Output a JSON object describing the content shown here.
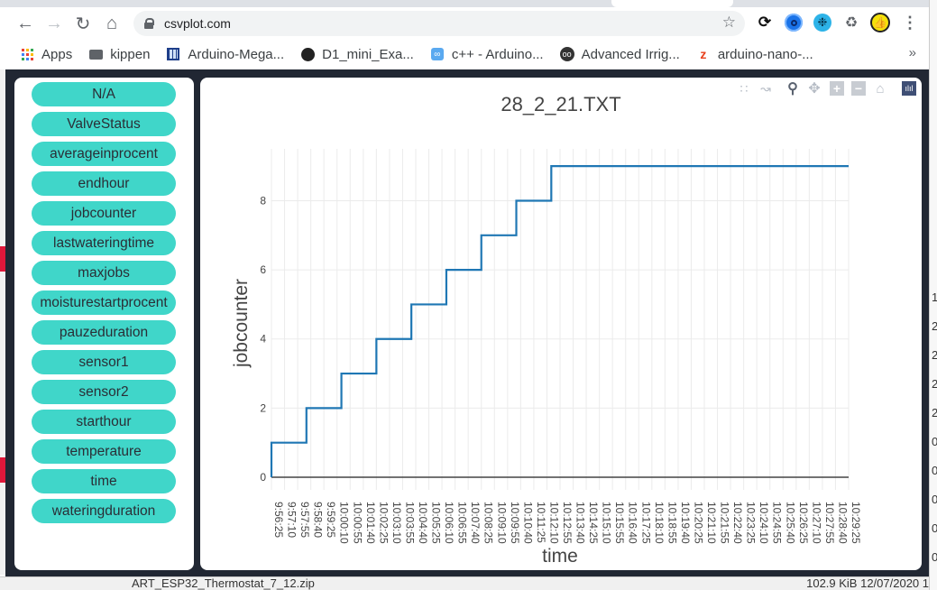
{
  "browser": {
    "url": "csvplot.com",
    "bookmarks": [
      {
        "label": "Apps",
        "icon": "apps-grid-icon"
      },
      {
        "label": "kippen",
        "icon": "folder-icon"
      },
      {
        "label": "Arduino-Mega...",
        "icon": "grid-site-icon"
      },
      {
        "label": "D1_mini_Exa...",
        "icon": "github-icon"
      },
      {
        "label": "c++ - Arduino...",
        "icon": "infinity-site-icon"
      },
      {
        "label": "Advanced Irrig...",
        "icon": "owl-site-icon"
      },
      {
        "label": "arduino-nano-...",
        "icon": "tz-site-icon"
      }
    ],
    "more_bookmarks": "»",
    "extensions": [
      "sync-icon",
      "blue-circle-extension-icon",
      "aperture-extension-icon",
      "puzzle-extensions-icon",
      "thumbs-up-avatar-icon"
    ]
  },
  "sidebar": {
    "columns": [
      "N/A",
      "ValveStatus",
      "averageinprocent",
      "endhour",
      "jobcounter",
      "lastwateringtime",
      "maxjobs",
      "moisturestartprocent",
      "pauzeduration",
      "sensor1",
      "sensor2",
      "starthour",
      "temperature",
      "time",
      "wateringduration"
    ]
  },
  "modebar": [
    "box-select-icon",
    "lasso-icon",
    "zoom-icon",
    "pan-icon",
    "zoom-in-icon",
    "zoom-out-icon",
    "reset-axes-home-icon",
    "plotly-logo-icon"
  ],
  "statusbar": {
    "filename": "ART_ESP32_Thermostat_7_12.zip",
    "meta": "102.9 KiB  12/07/2020 1"
  },
  "colors": {
    "line": "#1f77b4",
    "accent_button": "#40d6c9",
    "panel_bg": "#212733"
  },
  "chart_data": {
    "type": "line",
    "line_shape": "step",
    "title": "28_2_21.TXT",
    "xlabel": "time",
    "ylabel": "jobcounter",
    "x_ticks": [
      "9:56:25",
      "9:57:10",
      "9:57:55",
      "9:58:40",
      "9:59:25",
      "10:00:10",
      "10:00:55",
      "10:01:40",
      "10:02:25",
      "10:03:10",
      "10:03:55",
      "10:04:40",
      "10:05:25",
      "10:06:10",
      "10:06:55",
      "10:07:40",
      "10:08:25",
      "10:09:10",
      "10:09:55",
      "10:10:40",
      "10:11:25",
      "10:12:10",
      "10:12:55",
      "10:13:40",
      "10:14:25",
      "10:15:10",
      "10:15:55",
      "10:16:40",
      "10:17:25",
      "10:18:10",
      "10:18:55",
      "10:19:40",
      "10:20:25",
      "10:21:10",
      "10:21:55",
      "10:22:40",
      "10:23:25",
      "10:24:10",
      "10:24:55",
      "10:25:40",
      "10:26:25",
      "10:27:10",
      "10:27:55",
      "10:28:40",
      "10:29:25"
    ],
    "xlim": [
      "9:56:25",
      "10:29:25"
    ],
    "y_ticks": [
      0,
      2,
      4,
      6,
      8
    ],
    "ylim": [
      0,
      9.5
    ],
    "grid": true,
    "series": [
      {
        "name": "jobcounter",
        "x": [
          "9:56:25",
          "9:58:25",
          "10:00:25",
          "10:02:25",
          "10:04:25",
          "10:06:25",
          "10:08:25",
          "10:10:25",
          "10:12:25",
          "10:29:25"
        ],
        "y": [
          1,
          2,
          3,
          4,
          5,
          6,
          7,
          8,
          9,
          9
        ]
      }
    ]
  }
}
